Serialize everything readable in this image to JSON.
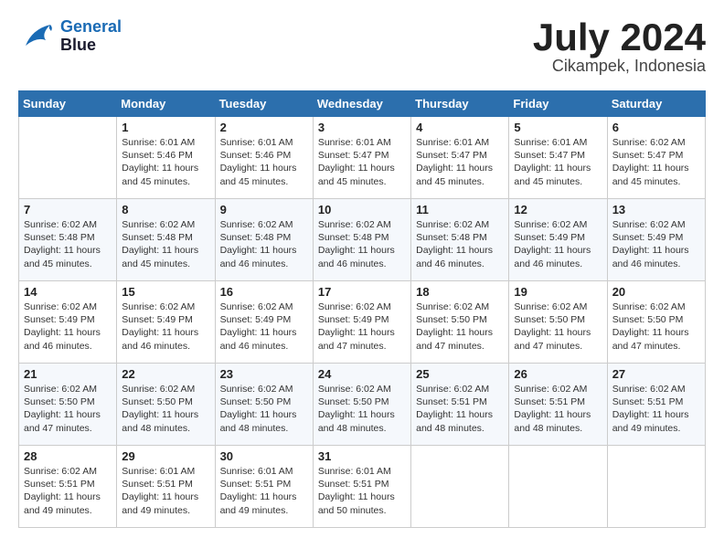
{
  "header": {
    "logo_line1": "General",
    "logo_line2": "Blue",
    "month": "July 2024",
    "location": "Cikampek, Indonesia"
  },
  "weekdays": [
    "Sunday",
    "Monday",
    "Tuesday",
    "Wednesday",
    "Thursday",
    "Friday",
    "Saturday"
  ],
  "weeks": [
    [
      {
        "day": "",
        "sunrise": "",
        "sunset": "",
        "daylight": ""
      },
      {
        "day": "1",
        "sunrise": "Sunrise: 6:01 AM",
        "sunset": "Sunset: 5:46 PM",
        "daylight": "Daylight: 11 hours and 45 minutes."
      },
      {
        "day": "2",
        "sunrise": "Sunrise: 6:01 AM",
        "sunset": "Sunset: 5:46 PM",
        "daylight": "Daylight: 11 hours and 45 minutes."
      },
      {
        "day": "3",
        "sunrise": "Sunrise: 6:01 AM",
        "sunset": "Sunset: 5:47 PM",
        "daylight": "Daylight: 11 hours and 45 minutes."
      },
      {
        "day": "4",
        "sunrise": "Sunrise: 6:01 AM",
        "sunset": "Sunset: 5:47 PM",
        "daylight": "Daylight: 11 hours and 45 minutes."
      },
      {
        "day": "5",
        "sunrise": "Sunrise: 6:01 AM",
        "sunset": "Sunset: 5:47 PM",
        "daylight": "Daylight: 11 hours and 45 minutes."
      },
      {
        "day": "6",
        "sunrise": "Sunrise: 6:02 AM",
        "sunset": "Sunset: 5:47 PM",
        "daylight": "Daylight: 11 hours and 45 minutes."
      }
    ],
    [
      {
        "day": "7",
        "sunrise": "Sunrise: 6:02 AM",
        "sunset": "Sunset: 5:48 PM",
        "daylight": "Daylight: 11 hours and 45 minutes."
      },
      {
        "day": "8",
        "sunrise": "Sunrise: 6:02 AM",
        "sunset": "Sunset: 5:48 PM",
        "daylight": "Daylight: 11 hours and 45 minutes."
      },
      {
        "day": "9",
        "sunrise": "Sunrise: 6:02 AM",
        "sunset": "Sunset: 5:48 PM",
        "daylight": "Daylight: 11 hours and 46 minutes."
      },
      {
        "day": "10",
        "sunrise": "Sunrise: 6:02 AM",
        "sunset": "Sunset: 5:48 PM",
        "daylight": "Daylight: 11 hours and 46 minutes."
      },
      {
        "day": "11",
        "sunrise": "Sunrise: 6:02 AM",
        "sunset": "Sunset: 5:48 PM",
        "daylight": "Daylight: 11 hours and 46 minutes."
      },
      {
        "day": "12",
        "sunrise": "Sunrise: 6:02 AM",
        "sunset": "Sunset: 5:49 PM",
        "daylight": "Daylight: 11 hours and 46 minutes."
      },
      {
        "day": "13",
        "sunrise": "Sunrise: 6:02 AM",
        "sunset": "Sunset: 5:49 PM",
        "daylight": "Daylight: 11 hours and 46 minutes."
      }
    ],
    [
      {
        "day": "14",
        "sunrise": "Sunrise: 6:02 AM",
        "sunset": "Sunset: 5:49 PM",
        "daylight": "Daylight: 11 hours and 46 minutes."
      },
      {
        "day": "15",
        "sunrise": "Sunrise: 6:02 AM",
        "sunset": "Sunset: 5:49 PM",
        "daylight": "Daylight: 11 hours and 46 minutes."
      },
      {
        "day": "16",
        "sunrise": "Sunrise: 6:02 AM",
        "sunset": "Sunset: 5:49 PM",
        "daylight": "Daylight: 11 hours and 46 minutes."
      },
      {
        "day": "17",
        "sunrise": "Sunrise: 6:02 AM",
        "sunset": "Sunset: 5:49 PM",
        "daylight": "Daylight: 11 hours and 47 minutes."
      },
      {
        "day": "18",
        "sunrise": "Sunrise: 6:02 AM",
        "sunset": "Sunset: 5:50 PM",
        "daylight": "Daylight: 11 hours and 47 minutes."
      },
      {
        "day": "19",
        "sunrise": "Sunrise: 6:02 AM",
        "sunset": "Sunset: 5:50 PM",
        "daylight": "Daylight: 11 hours and 47 minutes."
      },
      {
        "day": "20",
        "sunrise": "Sunrise: 6:02 AM",
        "sunset": "Sunset: 5:50 PM",
        "daylight": "Daylight: 11 hours and 47 minutes."
      }
    ],
    [
      {
        "day": "21",
        "sunrise": "Sunrise: 6:02 AM",
        "sunset": "Sunset: 5:50 PM",
        "daylight": "Daylight: 11 hours and 47 minutes."
      },
      {
        "day": "22",
        "sunrise": "Sunrise: 6:02 AM",
        "sunset": "Sunset: 5:50 PM",
        "daylight": "Daylight: 11 hours and 48 minutes."
      },
      {
        "day": "23",
        "sunrise": "Sunrise: 6:02 AM",
        "sunset": "Sunset: 5:50 PM",
        "daylight": "Daylight: 11 hours and 48 minutes."
      },
      {
        "day": "24",
        "sunrise": "Sunrise: 6:02 AM",
        "sunset": "Sunset: 5:50 PM",
        "daylight": "Daylight: 11 hours and 48 minutes."
      },
      {
        "day": "25",
        "sunrise": "Sunrise: 6:02 AM",
        "sunset": "Sunset: 5:51 PM",
        "daylight": "Daylight: 11 hours and 48 minutes."
      },
      {
        "day": "26",
        "sunrise": "Sunrise: 6:02 AM",
        "sunset": "Sunset: 5:51 PM",
        "daylight": "Daylight: 11 hours and 48 minutes."
      },
      {
        "day": "27",
        "sunrise": "Sunrise: 6:02 AM",
        "sunset": "Sunset: 5:51 PM",
        "daylight": "Daylight: 11 hours and 49 minutes."
      }
    ],
    [
      {
        "day": "28",
        "sunrise": "Sunrise: 6:02 AM",
        "sunset": "Sunset: 5:51 PM",
        "daylight": "Daylight: 11 hours and 49 minutes."
      },
      {
        "day": "29",
        "sunrise": "Sunrise: 6:01 AM",
        "sunset": "Sunset: 5:51 PM",
        "daylight": "Daylight: 11 hours and 49 minutes."
      },
      {
        "day": "30",
        "sunrise": "Sunrise: 6:01 AM",
        "sunset": "Sunset: 5:51 PM",
        "daylight": "Daylight: 11 hours and 49 minutes."
      },
      {
        "day": "31",
        "sunrise": "Sunrise: 6:01 AM",
        "sunset": "Sunset: 5:51 PM",
        "daylight": "Daylight: 11 hours and 50 minutes."
      },
      {
        "day": "",
        "sunrise": "",
        "sunset": "",
        "daylight": ""
      },
      {
        "day": "",
        "sunrise": "",
        "sunset": "",
        "daylight": ""
      },
      {
        "day": "",
        "sunrise": "",
        "sunset": "",
        "daylight": ""
      }
    ]
  ]
}
